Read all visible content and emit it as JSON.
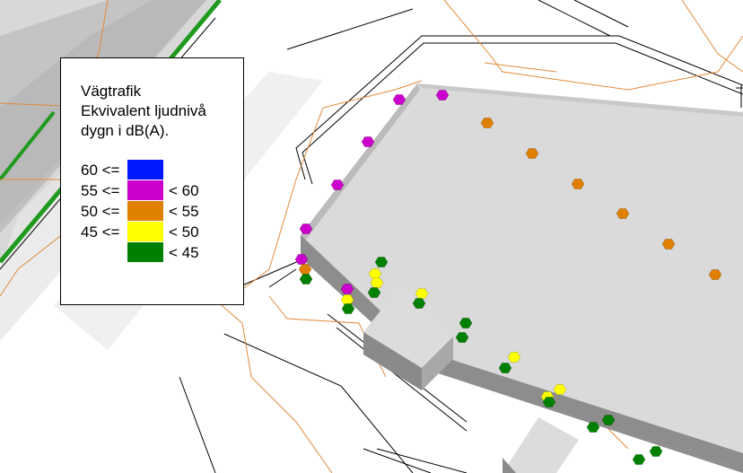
{
  "legend": {
    "title_lines": [
      "Vägtrafik",
      "Ekvivalent ljudnivå",
      "dygn i dB(A)."
    ],
    "rows": [
      {
        "lower": "60 <=",
        "upper": "",
        "color": "#0018ff"
      },
      {
        "lower": "55 <=",
        "upper": "< 60",
        "color": "#cc00cc"
      },
      {
        "lower": "50 <=",
        "upper": "< 55",
        "color": "#e08000"
      },
      {
        "lower": "45 <=",
        "upper": "< 50",
        "color": "#ffff00"
      },
      {
        "lower": "",
        "upper": "< 45",
        "color": "#008000"
      }
    ]
  },
  "colors": {
    "facade": "#8f8f8f",
    "roof": "#dadada",
    "ground": "#ffffff",
    "terrain": "#cfcfcf",
    "contour": "#e08a3a",
    "road_line": "#000000",
    "green_strip": "#1f9a1f"
  }
}
